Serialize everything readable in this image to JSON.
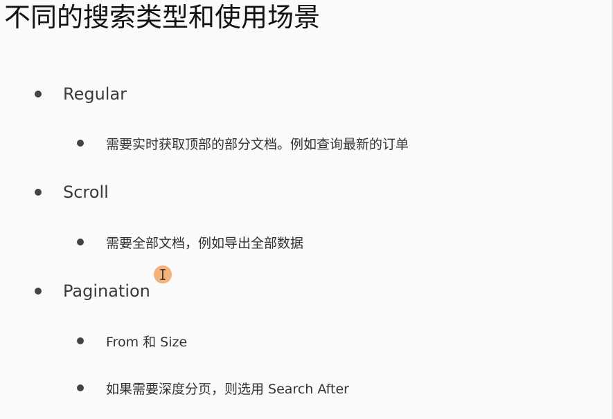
{
  "slide": {
    "title": "不同的搜索类型和使用场景",
    "items": [
      {
        "label": "Regular",
        "sub": [
          "需要实时获取顶部的部分文档。例如查询最新的订单"
        ]
      },
      {
        "label": "Scroll",
        "sub": [
          "需要全部文档，例如导出全部数据"
        ]
      },
      {
        "label": "Pagination",
        "sub": [
          "From 和 Size",
          "如果需要深度分页，则选用 Search After"
        ]
      }
    ]
  },
  "icons": {
    "bullet": "bullet-dot-icon",
    "cursor": "text-cursor-icon"
  },
  "colors": {
    "background": "#fafafa",
    "text": "#333333",
    "cursor_highlight": "#f2b27a"
  }
}
